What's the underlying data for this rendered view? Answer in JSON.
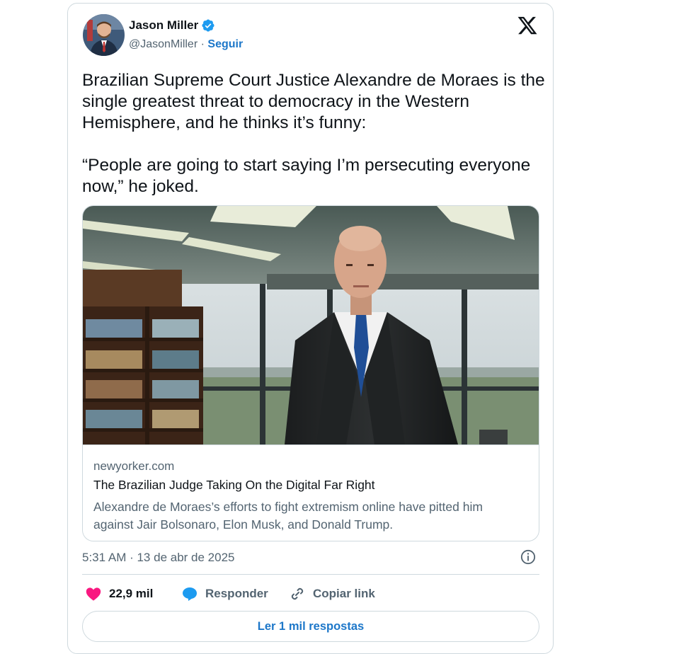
{
  "author": {
    "name": "Jason Miller",
    "handle": "@JasonMiller",
    "separator": "·",
    "follow_label": "Seguir"
  },
  "tweet": {
    "paragraphs": [
      "Brazilian Supreme Court Justice Alexandre de Moraes is the single greatest threat to democracy in the Western Hemisphere, and he thinks it’s funny:",
      "“People are going to start saying I’m persecuting everyone now,” he joked."
    ]
  },
  "link_card": {
    "domain": "newyorker.com",
    "title": "The Brazilian Judge Taking On the Digital Far Right",
    "description": "Alexandre de Moraes’s efforts to fight extremism online have pitted him against Jair Bolsonaro, Elon Musk, and Donald Trump."
  },
  "timestamp": "5:31 AM · 13 de abr de 2025",
  "actions": {
    "likes_count": "22,9 mil",
    "reply_label": "Responder",
    "copy_link_label": "Copiar link"
  },
  "replies_button": "Ler 1 mil respostas",
  "colors": {
    "link_blue": "#1d77c9",
    "verified_blue": "#1d9bf0",
    "heart": "#f91880",
    "muted_text": "#536471",
    "border": "#cfd9de"
  },
  "icons": [
    "verified-badge-icon",
    "x-logo-icon",
    "info-icon",
    "heart-icon",
    "reply-icon",
    "link-icon"
  ]
}
